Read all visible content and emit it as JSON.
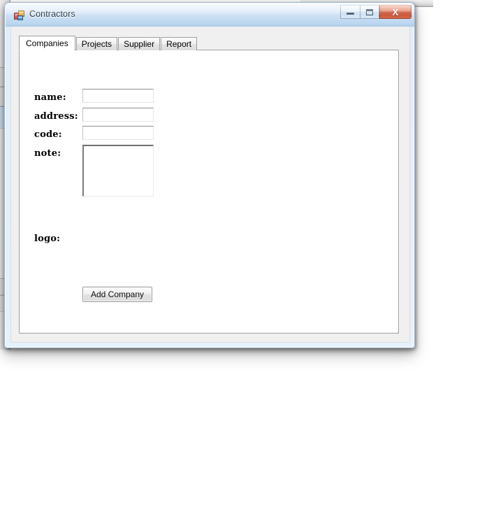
{
  "window": {
    "title": "Contractors",
    "icon": "winforms-app-icon",
    "controls": {
      "minimize": "–",
      "maximize": "□",
      "close": "X"
    }
  },
  "tabs": [
    {
      "label": "Companies",
      "active": true
    },
    {
      "label": "Projects",
      "active": false
    },
    {
      "label": "Supplier",
      "active": false
    },
    {
      "label": "Report",
      "active": false
    }
  ],
  "form": {
    "fields": [
      {
        "label": "name:",
        "value": "",
        "placeholder": ""
      },
      {
        "label": "address:",
        "value": "",
        "placeholder": ""
      },
      {
        "label": "code:",
        "value": "",
        "placeholder": ""
      },
      {
        "label": "note:",
        "value": "",
        "placeholder": ""
      }
    ],
    "logo_label": "logo:",
    "submit_label": "Add Company"
  },
  "colors": {
    "title_bar": "#cfe2f5",
    "close_button": "#c4492b",
    "window_border": "#9fb6cc",
    "tab_active": "#ffffff",
    "client_area": "#f0f0f0"
  }
}
